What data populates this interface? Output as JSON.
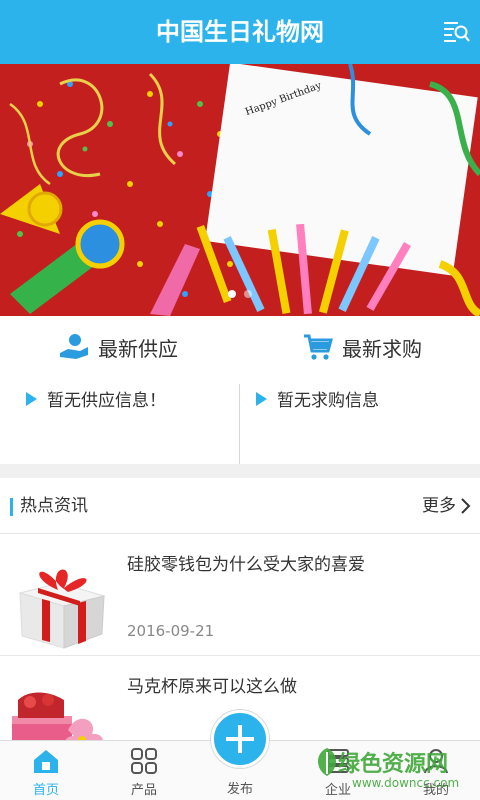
{
  "header": {
    "title": "中国生日礼物网",
    "menu_icon": "menu-search-icon"
  },
  "banner": {
    "slides": 2,
    "active_slide": 1,
    "card_text": "Happy Birthday"
  },
  "supply": {
    "title": "最新供应",
    "empty_text": "暂无供应信息！",
    "icon": "hand-coin-icon"
  },
  "demand": {
    "title": "最新求购",
    "empty_text": "暂无求购信息",
    "icon": "cart-icon"
  },
  "news": {
    "title": "热点资讯",
    "more": "更多",
    "items": [
      {
        "title": "硅胶零钱包为什么受大家的喜爱",
        "date": "2016-09-21"
      },
      {
        "title": "马克杯原来可以这么做",
        "date": ""
      }
    ]
  },
  "tabbar": {
    "home": "首页",
    "products": "产品",
    "publish": "发布",
    "company": "企业",
    "mine": "我的"
  },
  "watermark": {
    "text": "绿色资源网",
    "url": "www.downcc.com"
  },
  "colors": {
    "accent": "#2cb3ec",
    "watermark": "#3fa83a"
  }
}
